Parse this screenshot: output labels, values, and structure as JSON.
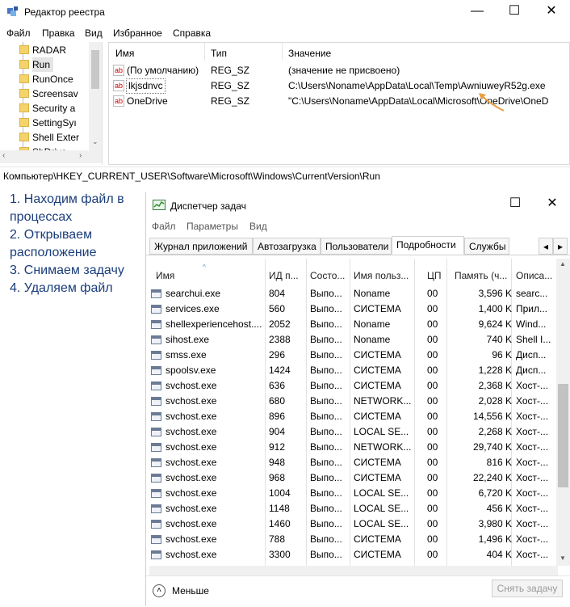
{
  "regedit": {
    "title": "Редактор реестра",
    "win_minimize": "—",
    "win_maximize": "☐",
    "win_close": "✕",
    "menu": [
      "Файл",
      "Правка",
      "Вид",
      "Избранное",
      "Справка"
    ],
    "tree": [
      "RADAR",
      "Run",
      "RunOnce",
      "Screensav",
      "Security a",
      "SettingSyı",
      "Shell Exter",
      "ShDrive"
    ],
    "columns": [
      "Имя",
      "Тип",
      "Значение"
    ],
    "rows": [
      {
        "name": "(По умолчанию)",
        "type": "REG_SZ",
        "value": "(значение не присвоено)"
      },
      {
        "name": "lkjsdnvc",
        "type": "REG_SZ",
        "value": "C:\\Users\\Noname\\AppData\\Local\\Temp\\AwniuweyR52g.exe"
      },
      {
        "name": "OneDrive",
        "type": "REG_SZ",
        "value": "\"C:\\Users\\Noname\\AppData\\Local\\Microsoft\\OneDrive\\OneD"
      }
    ],
    "status": "Компьютер\\HKEY_CURRENT_USER\\Software\\Microsoft\\Windows\\CurrentVersion\\Run"
  },
  "instructions": [
    "1. Находим файл в",
    "процессах",
    "2. Открываем",
    "расположение",
    "3. Снимаем задачу",
    "4. Удаляем файл"
  ],
  "taskmgr": {
    "title": "Диспетчер задач",
    "win_maximize": "☐",
    "win_close": "✕",
    "menu": [
      "Файл",
      "Параметры",
      "Вид"
    ],
    "tabs": [
      "Журнал приложений",
      "Автозагрузка",
      "Пользователи",
      "Подробности",
      "Службы"
    ],
    "active_tab": "Подробности",
    "columns": [
      "Имя",
      "ИД п...",
      "Состо...",
      "Имя польз...",
      "ЦП",
      "Память (ч...",
      "Описа..."
    ],
    "rows": [
      {
        "name": "searchui.exe",
        "pid": "804",
        "status": "Выпо...",
        "user": "Noname",
        "cpu": "00",
        "mem": "3,596 K",
        "desc": "searc..."
      },
      {
        "name": "services.exe",
        "pid": "560",
        "status": "Выпо...",
        "user": "СИСТЕМА",
        "cpu": "00",
        "mem": "1,400 K",
        "desc": "Прил..."
      },
      {
        "name": "shellexperiencehost....",
        "pid": "2052",
        "status": "Выпо...",
        "user": "Noname",
        "cpu": "00",
        "mem": "9,624 K",
        "desc": "Wind..."
      },
      {
        "name": "sihost.exe",
        "pid": "2388",
        "status": "Выпо...",
        "user": "Noname",
        "cpu": "00",
        "mem": "740 K",
        "desc": "Shell I..."
      },
      {
        "name": "smss.exe",
        "pid": "296",
        "status": "Выпо...",
        "user": "СИСТЕМА",
        "cpu": "00",
        "mem": "96 K",
        "desc": "Дисп..."
      },
      {
        "name": "spoolsv.exe",
        "pid": "1424",
        "status": "Выпо...",
        "user": "СИСТЕМА",
        "cpu": "00",
        "mem": "1,228 K",
        "desc": "Дисп..."
      },
      {
        "name": "svchost.exe",
        "pid": "636",
        "status": "Выпо...",
        "user": "СИСТЕМА",
        "cpu": "00",
        "mem": "2,368 K",
        "desc": "Хост-..."
      },
      {
        "name": "svchost.exe",
        "pid": "680",
        "status": "Выпо...",
        "user": "NETWORK...",
        "cpu": "00",
        "mem": "2,028 K",
        "desc": "Хост-..."
      },
      {
        "name": "svchost.exe",
        "pid": "896",
        "status": "Выпо...",
        "user": "СИСТЕМА",
        "cpu": "00",
        "mem": "14,556 K",
        "desc": "Хост-..."
      },
      {
        "name": "svchost.exe",
        "pid": "904",
        "status": "Выпо...",
        "user": "LOCAL SE...",
        "cpu": "00",
        "mem": "2,268 K",
        "desc": "Хост-..."
      },
      {
        "name": "svchost.exe",
        "pid": "912",
        "status": "Выпо...",
        "user": "NETWORK...",
        "cpu": "00",
        "mem": "29,740 K",
        "desc": "Хост-..."
      },
      {
        "name": "svchost.exe",
        "pid": "948",
        "status": "Выпо...",
        "user": "СИСТЕМА",
        "cpu": "00",
        "mem": "816 K",
        "desc": "Хост-..."
      },
      {
        "name": "svchost.exe",
        "pid": "968",
        "status": "Выпо...",
        "user": "СИСТЕМА",
        "cpu": "00",
        "mem": "22,240 K",
        "desc": "Хост-..."
      },
      {
        "name": "svchost.exe",
        "pid": "1004",
        "status": "Выпо...",
        "user": "LOCAL SE...",
        "cpu": "00",
        "mem": "6,720 K",
        "desc": "Хост-..."
      },
      {
        "name": "svchost.exe",
        "pid": "1148",
        "status": "Выпо...",
        "user": "LOCAL SE...",
        "cpu": "00",
        "mem": "456 K",
        "desc": "Хост-..."
      },
      {
        "name": "svchost.exe",
        "pid": "1460",
        "status": "Выпо...",
        "user": "LOCAL SE...",
        "cpu": "00",
        "mem": "3,980 K",
        "desc": "Хост-..."
      },
      {
        "name": "svchost.exe",
        "pid": "788",
        "status": "Выпо...",
        "user": "СИСТЕМА",
        "cpu": "00",
        "mem": "1,496 K",
        "desc": "Хост-..."
      },
      {
        "name": "svchost.exe",
        "pid": "3300",
        "status": "Выпо...",
        "user": "СИСТЕМА",
        "cpu": "00",
        "mem": "404 K",
        "desc": "Хост-..."
      }
    ],
    "fewer_label": "Меньше",
    "end_task_label": "Снять задачу"
  },
  "colors": {
    "instruction_text": "#1a3d7a",
    "folder": "#f4d36b",
    "annotation_arrow": "#e8a040"
  }
}
